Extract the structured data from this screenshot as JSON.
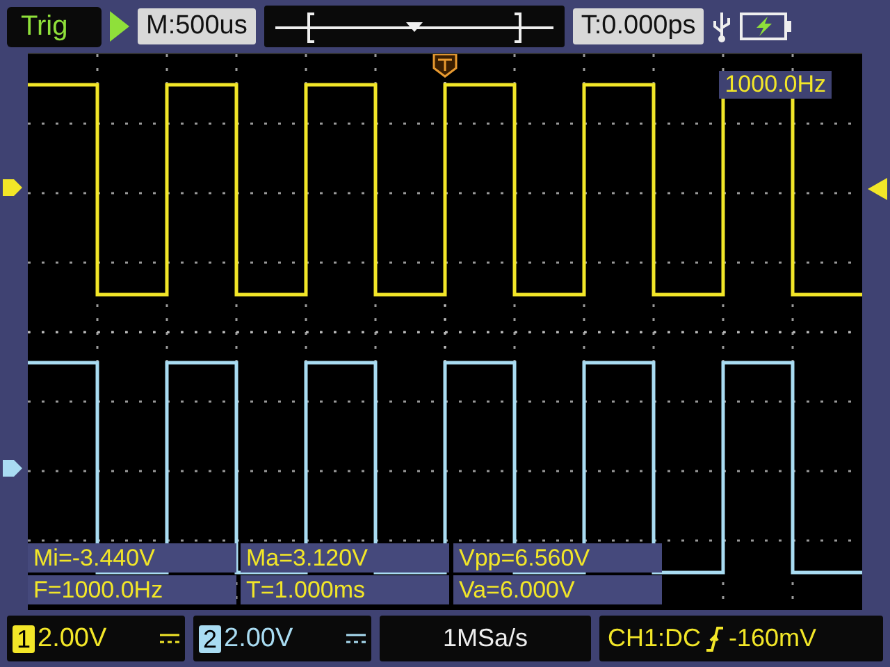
{
  "top_bar": {
    "status": "Trig",
    "timebase": "M:500us",
    "trigger_offset": "T:0.000ps"
  },
  "screen": {
    "frequency_readout": "1000.0Hz",
    "measurements": [
      "Mi=-3.440V",
      "Ma=3.120V",
      "Vpp=6.560V",
      "F=1000.0Hz",
      "T=1.000ms",
      "Va=6.000V"
    ]
  },
  "channels": [
    {
      "number": "1",
      "scale": "2.00V",
      "color": "#f2e628"
    },
    {
      "number": "2",
      "scale": "2.00V",
      "color": "#a9dcf2"
    }
  ],
  "sample_rate": "1MSa/s",
  "trigger": {
    "source": "CH1:DC",
    "level": "-160mV"
  }
}
